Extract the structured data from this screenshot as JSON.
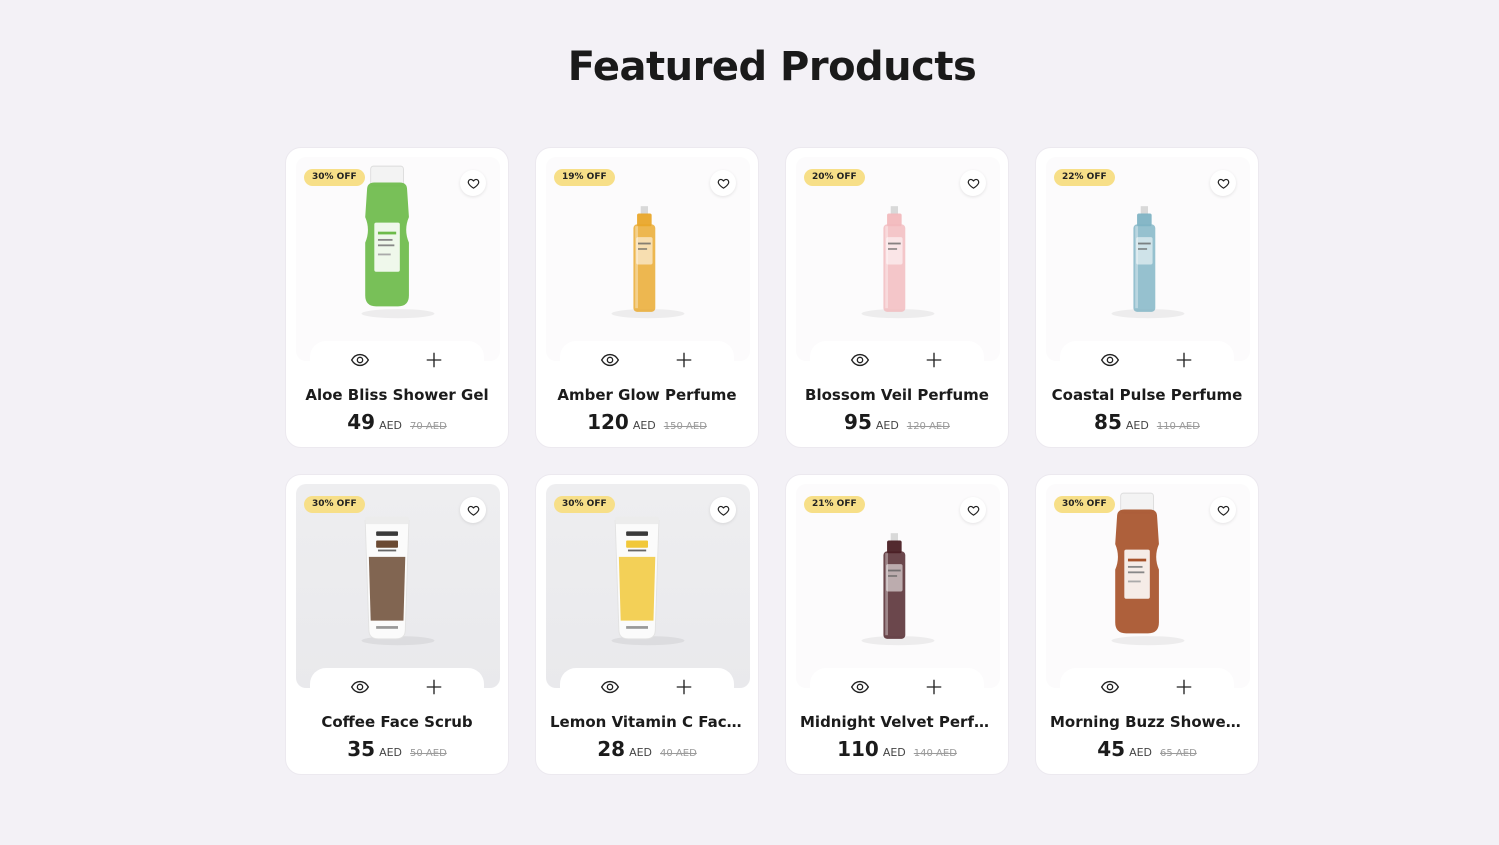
{
  "section": {
    "title": "Featured Products"
  },
  "products": [
    {
      "name": "Aloe Bliss Shower Gel",
      "badge": "30% OFF",
      "price": "49",
      "currency": "AED",
      "old_price": "70 AED",
      "image": "aloe-shower-gel-bottle",
      "bg": "white",
      "color": "#6dbb4a"
    },
    {
      "name": "Amber Glow Perfume",
      "badge": "19% OFF",
      "price": "120",
      "currency": "AED",
      "old_price": "150 AED",
      "image": "amber-perfume-bottle",
      "bg": "white",
      "color": "#e9a72a"
    },
    {
      "name": "Blossom Veil Perfume",
      "badge": "20% OFF",
      "price": "95",
      "currency": "AED",
      "old_price": "120 AED",
      "image": "blossom-perfume-bottle",
      "bg": "white",
      "color": "#f2b9bd"
    },
    {
      "name": "Coastal Pulse Perfume",
      "badge": "22% OFF",
      "price": "85",
      "currency": "AED",
      "old_price": "110 AED",
      "image": "coastal-perfume-bottle",
      "bg": "white",
      "color": "#7fb3c4"
    },
    {
      "name": "Coffee Face Scrub",
      "badge": "30% OFF",
      "price": "35",
      "currency": "AED",
      "old_price": "50 AED",
      "image": "coffee-scrub-tube",
      "bg": "grey",
      "color": "#6b4a33"
    },
    {
      "name": "Lemon Vitamin C Face ...",
      "badge": "30% OFF",
      "price": "28",
      "currency": "AED",
      "old_price": "40 AED",
      "image": "lemon-face-wash-tube",
      "bg": "grey",
      "color": "#f1c83a"
    },
    {
      "name": "Midnight Velvet Perfu...",
      "badge": "21% OFF",
      "price": "110",
      "currency": "AED",
      "old_price": "140 AED",
      "image": "midnight-perfume-bottle",
      "bg": "white",
      "color": "#4a1f24"
    },
    {
      "name": "Morning Buzz Shower ...",
      "badge": "30% OFF",
      "price": "45",
      "currency": "AED",
      "old_price": "65 AED",
      "image": "coffee-shower-gel-bottle",
      "bg": "white",
      "color": "#a7522a"
    }
  ],
  "icons": {
    "favorite": "heart-icon",
    "quick_view": "eye-icon",
    "add_to_cart": "plus-icon"
  }
}
